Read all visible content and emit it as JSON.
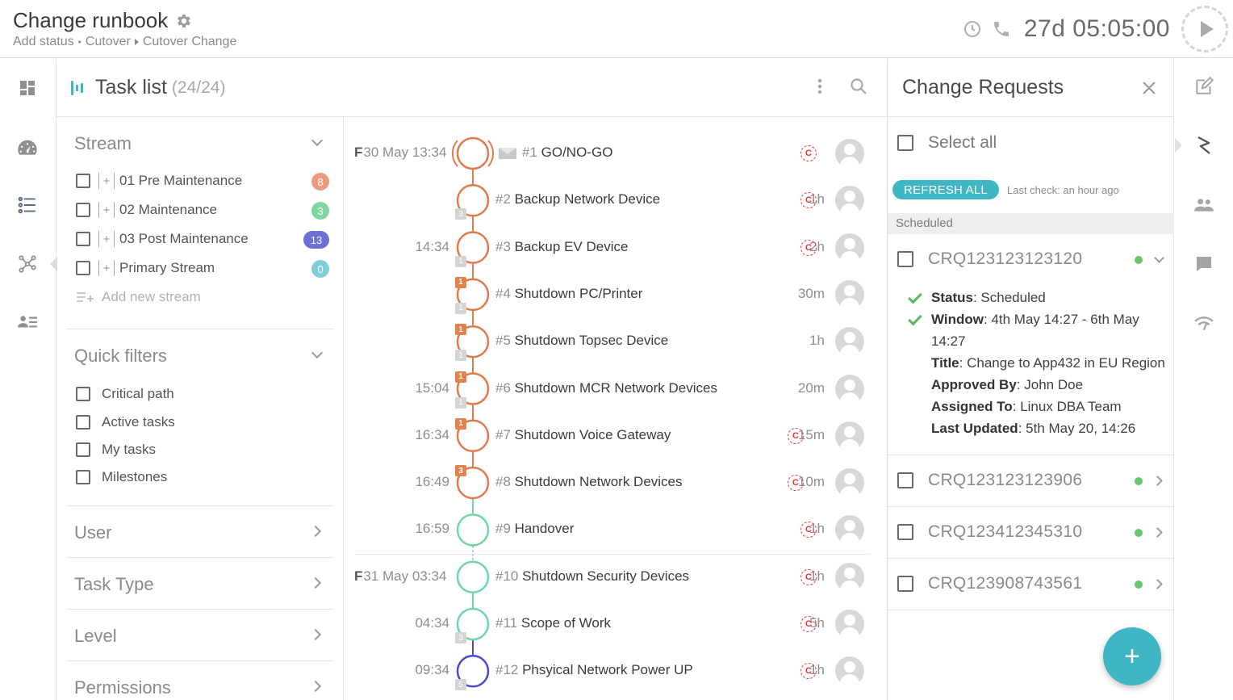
{
  "header": {
    "title": "Change runbook",
    "breadcrumbs": [
      "Add status",
      "Cutover",
      "Cutover Change"
    ],
    "countdown": "27d 05:05:00"
  },
  "tasklist": {
    "title": "Task list",
    "count": "(24/24)"
  },
  "filters": {
    "stream_title": "Stream",
    "streams": [
      {
        "label": "01 Pre Maintenance",
        "count": "8",
        "color": "#eb9c7f"
      },
      {
        "label": "02 Maintenance",
        "count": "3",
        "color": "#7fd6a2"
      },
      {
        "label": "03 Post Maintenance",
        "count": "13",
        "color": "#6b6fd8"
      },
      {
        "label": "Primary Stream",
        "count": "0",
        "color": "#7fcfd9"
      }
    ],
    "add_stream": "Add new stream",
    "quick_title": "Quick filters",
    "quick": [
      "Critical path",
      "Active tasks",
      "My tasks",
      "Milestones"
    ],
    "sections": [
      "User",
      "Task Type",
      "Level",
      "Permissions"
    ]
  },
  "tasks": [
    {
      "time_prefix": "F",
      "time": "30 May 13:34",
      "num": "#1",
      "name": "GO/NO-GO",
      "dur": "",
      "crit": true,
      "ring": "#e07b4c",
      "milestone": true
    },
    {
      "time_prefix": "",
      "time": "",
      "num": "#2",
      "name": "Backup Network Device",
      "dur": "1h",
      "crit": true,
      "ring": "#e07b4c",
      "pred": "3"
    },
    {
      "time_prefix": "",
      "time": "14:34",
      "num": "#3",
      "name": "Backup EV Device",
      "dur": "2h",
      "crit": true,
      "ring": "#e07b4c",
      "pred": "1"
    },
    {
      "time_prefix": "",
      "time": "",
      "num": "#4",
      "name": "Shutdown PC/Printer",
      "dur": "30m",
      "crit": false,
      "ring": "#e07b4c",
      "pred": "1",
      "succ": "1"
    },
    {
      "time_prefix": "",
      "time": "",
      "num": "#5",
      "name": "Shutdown Topsec Device",
      "dur": "1h",
      "crit": false,
      "ring": "#e07b4c",
      "pred": "1",
      "succ": "1"
    },
    {
      "time_prefix": "",
      "time": "15:04",
      "num": "#6",
      "name": "Shutdown MCR Network Devices",
      "dur": "20m",
      "crit": false,
      "ring": "#e07b4c",
      "pred": "1",
      "succ": "1"
    },
    {
      "time_prefix": "",
      "time": "16:34",
      "num": "#7",
      "name": "Shutdown Voice Gateway",
      "dur": "15m",
      "crit": true,
      "ring": "#e07b4c",
      "succ": "1"
    },
    {
      "time_prefix": "",
      "time": "16:49",
      "num": "#8",
      "name": "Shutdown Network Devices",
      "dur": "10m",
      "crit": true,
      "ring": "#e07b4c",
      "succ": "3"
    },
    {
      "time_prefix": "",
      "time": "16:59",
      "num": "#9",
      "name": "Handover",
      "dur": "1h",
      "crit": true,
      "ring": "#6fd6a8"
    },
    {
      "time_prefix": "F",
      "time": "31 May 03:34",
      "num": "#10",
      "name": "Shutdown Security Devices",
      "dur": "1h",
      "crit": true,
      "ring": "#6fd6a8"
    },
    {
      "time_prefix": "",
      "time": "04:34",
      "num": "#11",
      "name": "Scope of Work",
      "dur": "5h",
      "crit": true,
      "ring": "#6fd6a8",
      "pred": "3"
    },
    {
      "time_prefix": "",
      "time": "09:34",
      "num": "#12",
      "name": "Phsyical Network Power UP",
      "dur": "1h",
      "crit": true,
      "ring": "#4a4ad0",
      "pred": "5"
    }
  ],
  "crit_letter": "C",
  "change_requests": {
    "title": "Change Requests",
    "select_all": "Select all",
    "refresh": "REFRESH ALL",
    "last_check": "Last check: an hour ago",
    "group": "Scheduled",
    "items": [
      "CRQ123123123120",
      "CRQ123123123906",
      "CRQ123412345310",
      "CRQ123908743561"
    ],
    "details": {
      "status_label": "Status",
      "status": "Scheduled",
      "window_label": "Window",
      "window": "4th May 14:27 - 6th May 14:27",
      "title_label": "Title",
      "title": "Change to App432 in EU Region",
      "approved_label": "Approved By",
      "approved": "John Doe",
      "assigned_label": "Assigned To",
      "assigned": "Linux DBA Team",
      "updated_label": "Last Updated",
      "updated": "5th May 20, 14:26"
    },
    "fab": "+"
  }
}
